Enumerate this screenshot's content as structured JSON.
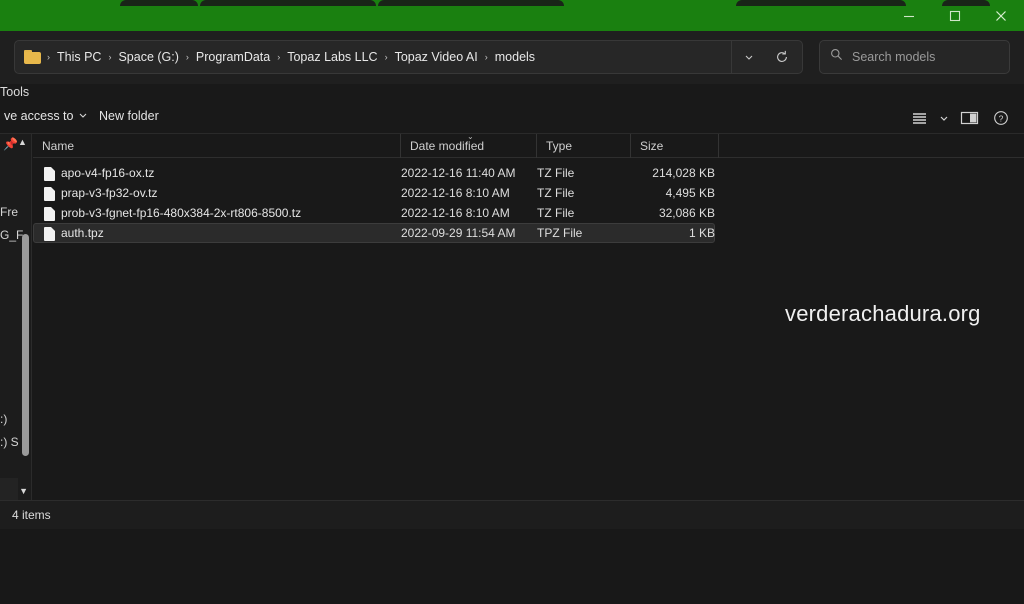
{
  "window": {
    "accent_color": "#1a8010",
    "chrome_color": "#1f1f1f",
    "body_color": "#191919",
    "controls": {
      "minimize_label": "Minimize",
      "maximize_label": "Maximize",
      "close_label": "Close"
    },
    "tab_fragments": [
      "",
      "",
      "",
      "",
      ""
    ]
  },
  "address_bar": {
    "folder_icon": "folder-icon",
    "breadcrumbs": [
      "This PC",
      "Space (G:)",
      "ProgramData",
      "Topaz Labs LLC",
      "Topaz Video AI",
      "models"
    ],
    "separator": "›",
    "history_dropdown_icon": "chevron-down-icon",
    "refresh_icon": "refresh-icon"
  },
  "search": {
    "icon": "search-icon",
    "placeholder": "Search models",
    "value": ""
  },
  "menu_strip": {
    "items": [
      "Tools"
    ]
  },
  "command_bar": {
    "give_access_label": "ve access to",
    "give_access_chevron": "⌄",
    "new_folder_label": "New folder",
    "view_icon": "list-view-icon",
    "view_chevron_icon": "chevron-down-icon",
    "preview_pane_icon": "preview-pane-icon",
    "help_icon": "help-icon"
  },
  "left_nav": {
    "pin_icon": "pin-icon",
    "scroll_up_icon": "scroll-up-arrow-icon",
    "scroll_down_icon": "scroll-down-arrow-icon",
    "fragments": [
      "Fre",
      "G_F",
      ":)",
      ":) S"
    ]
  },
  "file_list": {
    "columns": [
      {
        "label": "Name",
        "sorted": false
      },
      {
        "label": "Date modified",
        "sorted": true
      },
      {
        "label": "Type",
        "sorted": false
      },
      {
        "label": "Size",
        "sorted": false
      }
    ],
    "sort_marker": "⌄",
    "rows": [
      {
        "name": "apo-v4-fp16-ox.tz",
        "date": "2022-12-16 11:40 AM",
        "type": "TZ File",
        "size": "214,028 KB",
        "selected": false
      },
      {
        "name": "prap-v3-fp32-ov.tz",
        "date": "2022-12-16 8:10 AM",
        "type": "TZ File",
        "size": "4,495 KB",
        "selected": false
      },
      {
        "name": "prob-v3-fgnet-fp16-480x384-2x-rt806-8500.tz",
        "date": "2022-12-16 8:10 AM",
        "type": "TZ File",
        "size": "32,086 KB",
        "selected": false
      },
      {
        "name": "auth.tpz",
        "date": "2022-09-29 11:54 AM",
        "type": "TPZ File",
        "size": "1 KB",
        "selected": true
      }
    ]
  },
  "watermark": {
    "text": "verderachadura.org"
  },
  "status_bar": {
    "item_count_label": "4 items"
  }
}
